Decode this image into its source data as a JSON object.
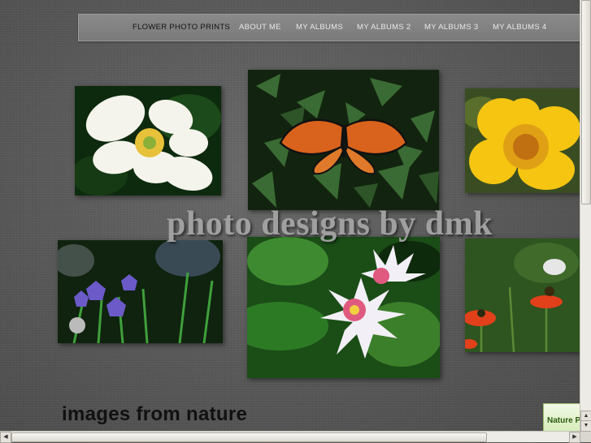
{
  "nav": {
    "items": [
      {
        "label": "FLOWER PHOTO PRINTS",
        "active": true
      },
      {
        "label": "ABOUT ME",
        "active": false
      },
      {
        "label": "MY ALBUMS",
        "active": false
      },
      {
        "label": "MY ALBUMS 2",
        "active": false
      },
      {
        "label": "MY ALBUMS 3",
        "active": false
      },
      {
        "label": "MY ALBUMS 4",
        "active": false
      }
    ]
  },
  "hero": {
    "title": "photo designs by dmk",
    "subtitle": "images from nature"
  },
  "photos": [
    {
      "subject": "white-flower-photo"
    },
    {
      "subject": "monarch-butterfly-photo"
    },
    {
      "subject": "yellow-marigold-photo"
    },
    {
      "subject": "blue-bellflowers-photo"
    },
    {
      "subject": "water-lilies-photo"
    },
    {
      "subject": "orange-flowers-bee-photo"
    }
  ],
  "widget": {
    "label": "Nature P"
  },
  "colors": {
    "background": "#5a5a5a",
    "nav_bg": "#7f7f7f",
    "title": "#a0a0a0"
  }
}
